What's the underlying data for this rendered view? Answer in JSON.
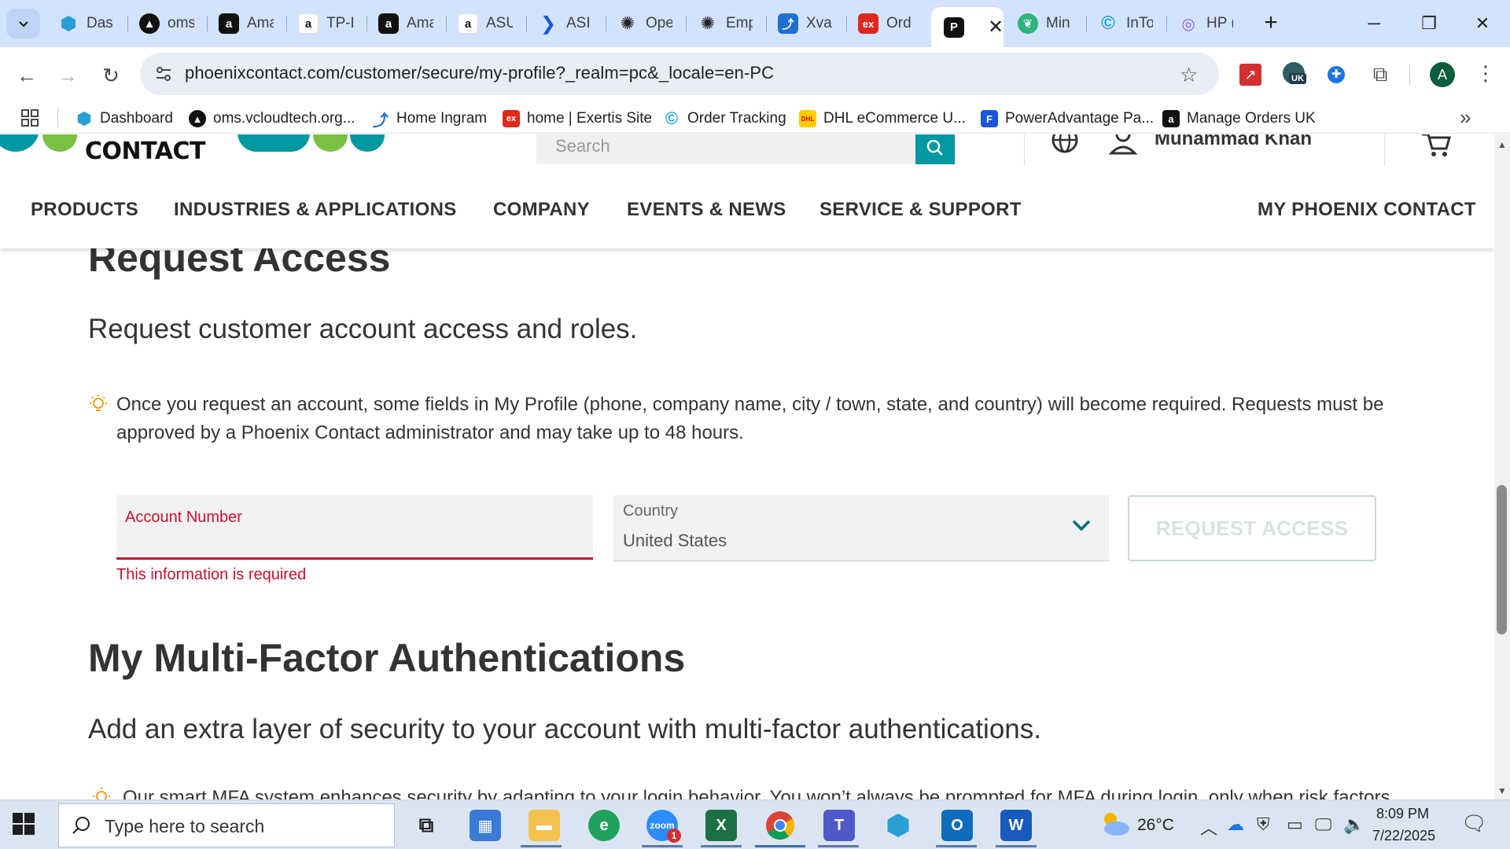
{
  "browser": {
    "tabs": [
      {
        "label": "Dash",
        "icon": "hexagon-dashboard-icon",
        "color": "#2a7fc7"
      },
      {
        "label": "oms",
        "icon": "oms-triangle-icon",
        "color": "#111111"
      },
      {
        "label": "Ama",
        "icon": "amazon-icon",
        "color": "#111111"
      },
      {
        "label": "TP-L",
        "icon": "amazon-smile-icon",
        "color": "#ff9900"
      },
      {
        "label": "Ama",
        "icon": "amazon-icon",
        "color": "#111111"
      },
      {
        "label": "ASU",
        "icon": "amazon-smile-icon",
        "color": "#ff9900"
      },
      {
        "label": "ASI",
        "icon": "play-arrow-icon",
        "color": "#1a56db"
      },
      {
        "label": "Ope",
        "icon": "openai-icon",
        "color": "#222222"
      },
      {
        "label": "Emp",
        "icon": "openai-icon",
        "color": "#222222"
      },
      {
        "label": "Xva",
        "icon": "xvantage-icon",
        "color": "#1f6fd1"
      },
      {
        "label": "Ord",
        "icon": "exertis-icon",
        "color": "#e1261c"
      },
      {
        "label": "",
        "icon": "phoenix-contact-icon",
        "color": "#111111"
      },
      {
        "label": "Min",
        "icon": "leaf-icon",
        "color": "#2fb37a"
      },
      {
        "label": "InTo",
        "icon": "c-circle-icon",
        "color": "#1aa3d6"
      },
      {
        "label": "HP (",
        "icon": "hp-icon",
        "color": "#8b5cf6"
      }
    ],
    "url": "phoenixcontact.com/customer/secure/my-profile?_realm=pc&_locale=en-PC",
    "avatar_letter": "A",
    "ext_badge": "UK",
    "bookmarks": [
      {
        "label": "Dashboard",
        "icon": "hexagon-dashboard-icon",
        "color": "#2a7fc7"
      },
      {
        "label": "oms.vcloudtech.org...",
        "icon": "oms-triangle-icon",
        "color": "#111111"
      },
      {
        "label": "Home Ingram",
        "icon": "ingram-icon",
        "color": "#1f6fd1"
      },
      {
        "label": "home | Exertis Site",
        "icon": "exertis-icon",
        "color": "#e1261c"
      },
      {
        "label": "Order Tracking",
        "icon": "c-circle-icon",
        "color": "#1aa3d6"
      },
      {
        "label": "DHL eCommerce U...",
        "icon": "dhl-icon",
        "color": "#ffcc00"
      },
      {
        "label": "PowerAdvantage Pa...",
        "icon": "flag-icon",
        "color": "#1a56db"
      },
      {
        "label": "Manage Orders UK",
        "icon": "amazon-icon",
        "color": "#111111"
      }
    ]
  },
  "site": {
    "logo_text": "CONTACT",
    "search_placeholder": "Search",
    "user_name": "Muhammad Khan",
    "nav": [
      "PRODUCTS",
      "INDUSTRIES & APPLICATIONS",
      "COMPANY",
      "EVENTS & NEWS",
      "SERVICE & SUPPORT",
      "MY PHOENIX CONTACT"
    ]
  },
  "request_access": {
    "title": "Request Access",
    "lead": "Request customer account access and roles.",
    "notice": "Once you request an account, some fields in My Profile (phone, company name, city / town, state, and country) will become required. Requests must be approved by a Phoenix Contact administrator and may take up to 48 hours.",
    "account_label": "Account Number",
    "account_error": "This information is required",
    "country_label": "Country",
    "country_value": "United States",
    "button": "REQUEST ACCESS"
  },
  "mfa": {
    "title": "My Multi-Factor Authentications",
    "lead": "Add an extra layer of security to your account with multi-factor authentications.",
    "notice": "Our smart MFA system enhances security by adapting to your login behavior. You won’t always be prompted for MFA during login, only when risk factors"
  },
  "taskbar": {
    "search_placeholder": "Type here to search",
    "temperature": "26°C",
    "time": "8:09 PM",
    "date": "7/22/2025",
    "zoom_badge": "1"
  }
}
